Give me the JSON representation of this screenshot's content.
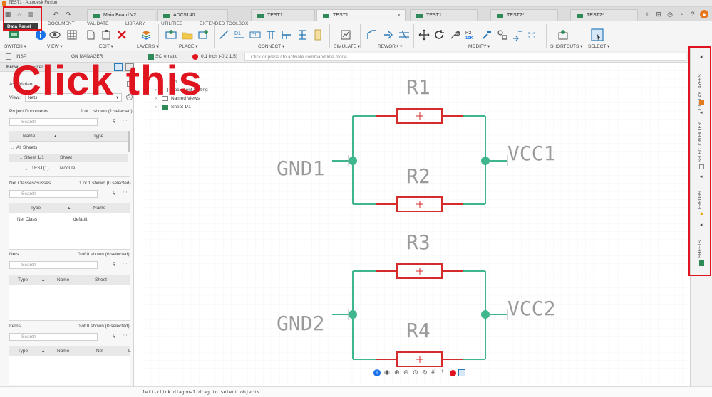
{
  "window": {
    "title": "TEST1 - Autodesk Fusion"
  },
  "tooltip": "Data Panel",
  "tabs": [
    {
      "label": "Main Board V2",
      "active": false
    },
    {
      "label": "ADC5140",
      "active": false
    },
    {
      "label": "TEST1",
      "active": false
    },
    {
      "label": "TEST1",
      "active": true
    },
    {
      "label": "TEST1",
      "active": false
    },
    {
      "label": "TEST2*",
      "active": false
    },
    {
      "label": "TEST2*",
      "active": false
    }
  ],
  "menu": {
    "document": "DOCUMENT",
    "validate": "VALIDATE",
    "library": "LIBRARY",
    "utilities": "UTILITIES",
    "extended_toolbox": "EXTENDED TOOLBOX"
  },
  "groups": {
    "switch": "SWITCH ▾",
    "view": "VIEW ▾",
    "edit": "EDIT ▾",
    "layers": "LAYERS ▾",
    "place": "PLACE ▾",
    "connect": "CONNECT ▾",
    "simulate": "SIMULATE ▾",
    "rework": "REWORK ▾",
    "modify": "MODIFY ▾",
    "shortcuts": "SHORTCUTS ▾",
    "select": "SELECT ▾"
  },
  "panel_header": {
    "inspector": "INSP",
    "design_manager": "GN MANAGER",
    "schematic_tab": "SC",
    "hematic": "ematic",
    "grid": "0.1 inch (-0.2 1.5)",
    "command_placeholder": "Click or press / to activate command line mode"
  },
  "browser": {
    "tab_browser": "Brow",
    "tab_filter": "Filter",
    "assign_row": "Assi     Variant",
    "view_label": "View:",
    "view_value": "Nets",
    "project_documents": "Project Documents",
    "project_documents_count": "1 of 1 shown (1 selected)",
    "search": "Search",
    "col_name": "Name",
    "col_type": "Type",
    "rows": [
      {
        "name": "All Sheets",
        "type": ""
      },
      {
        "name": "Sheet 1/1",
        "type": "Sheet"
      },
      {
        "name": "TEST(1)",
        "type": "Module"
      }
    ],
    "net_classes": "Net Classes/Busses",
    "net_classes_count": "1 of 1 shown (0 selected)",
    "nc_col_type": "Type",
    "nc_col_name": "Name",
    "nc_row_type": "Net Class",
    "nc_row_name": "default",
    "nets": "Nets",
    "nets_count": "0 of 0 shown (0 selected)",
    "nets_col_type": "Type",
    "nets_col_name": "Name",
    "nets_col_sheet": "Sheet",
    "items": "Items",
    "items_count": "0 of 0 shown (0 selected)",
    "items_col_type": "Type",
    "items_col_name": "Name",
    "items_col_net": "Net",
    "items_col_l": "L"
  },
  "tree": {
    "root": "ST1",
    "doc_settings": "Document Setting",
    "named_views": "Named Views",
    "sheet": "Sheet 1/1"
  },
  "schematic": {
    "r1": "R1",
    "r2": "R2",
    "r3": "R3",
    "r4": "R4",
    "gnd1": "GND1",
    "vcc1": "VCC1",
    "gnd2": "GND2",
    "vcc2": "VCC2",
    "wire_color": "#3fb68b",
    "resistor_color": "#d52b2b",
    "label_color": "#9a9a9a"
  },
  "right_panel": {
    "display_layers": "DISPLAY LAYERS",
    "selection_filter": "SELECTION FILTER",
    "errors": "ERRORS",
    "sheets": "SHEETS"
  },
  "status": "left-click diagonal drag to select objects",
  "annotation": "Click this"
}
